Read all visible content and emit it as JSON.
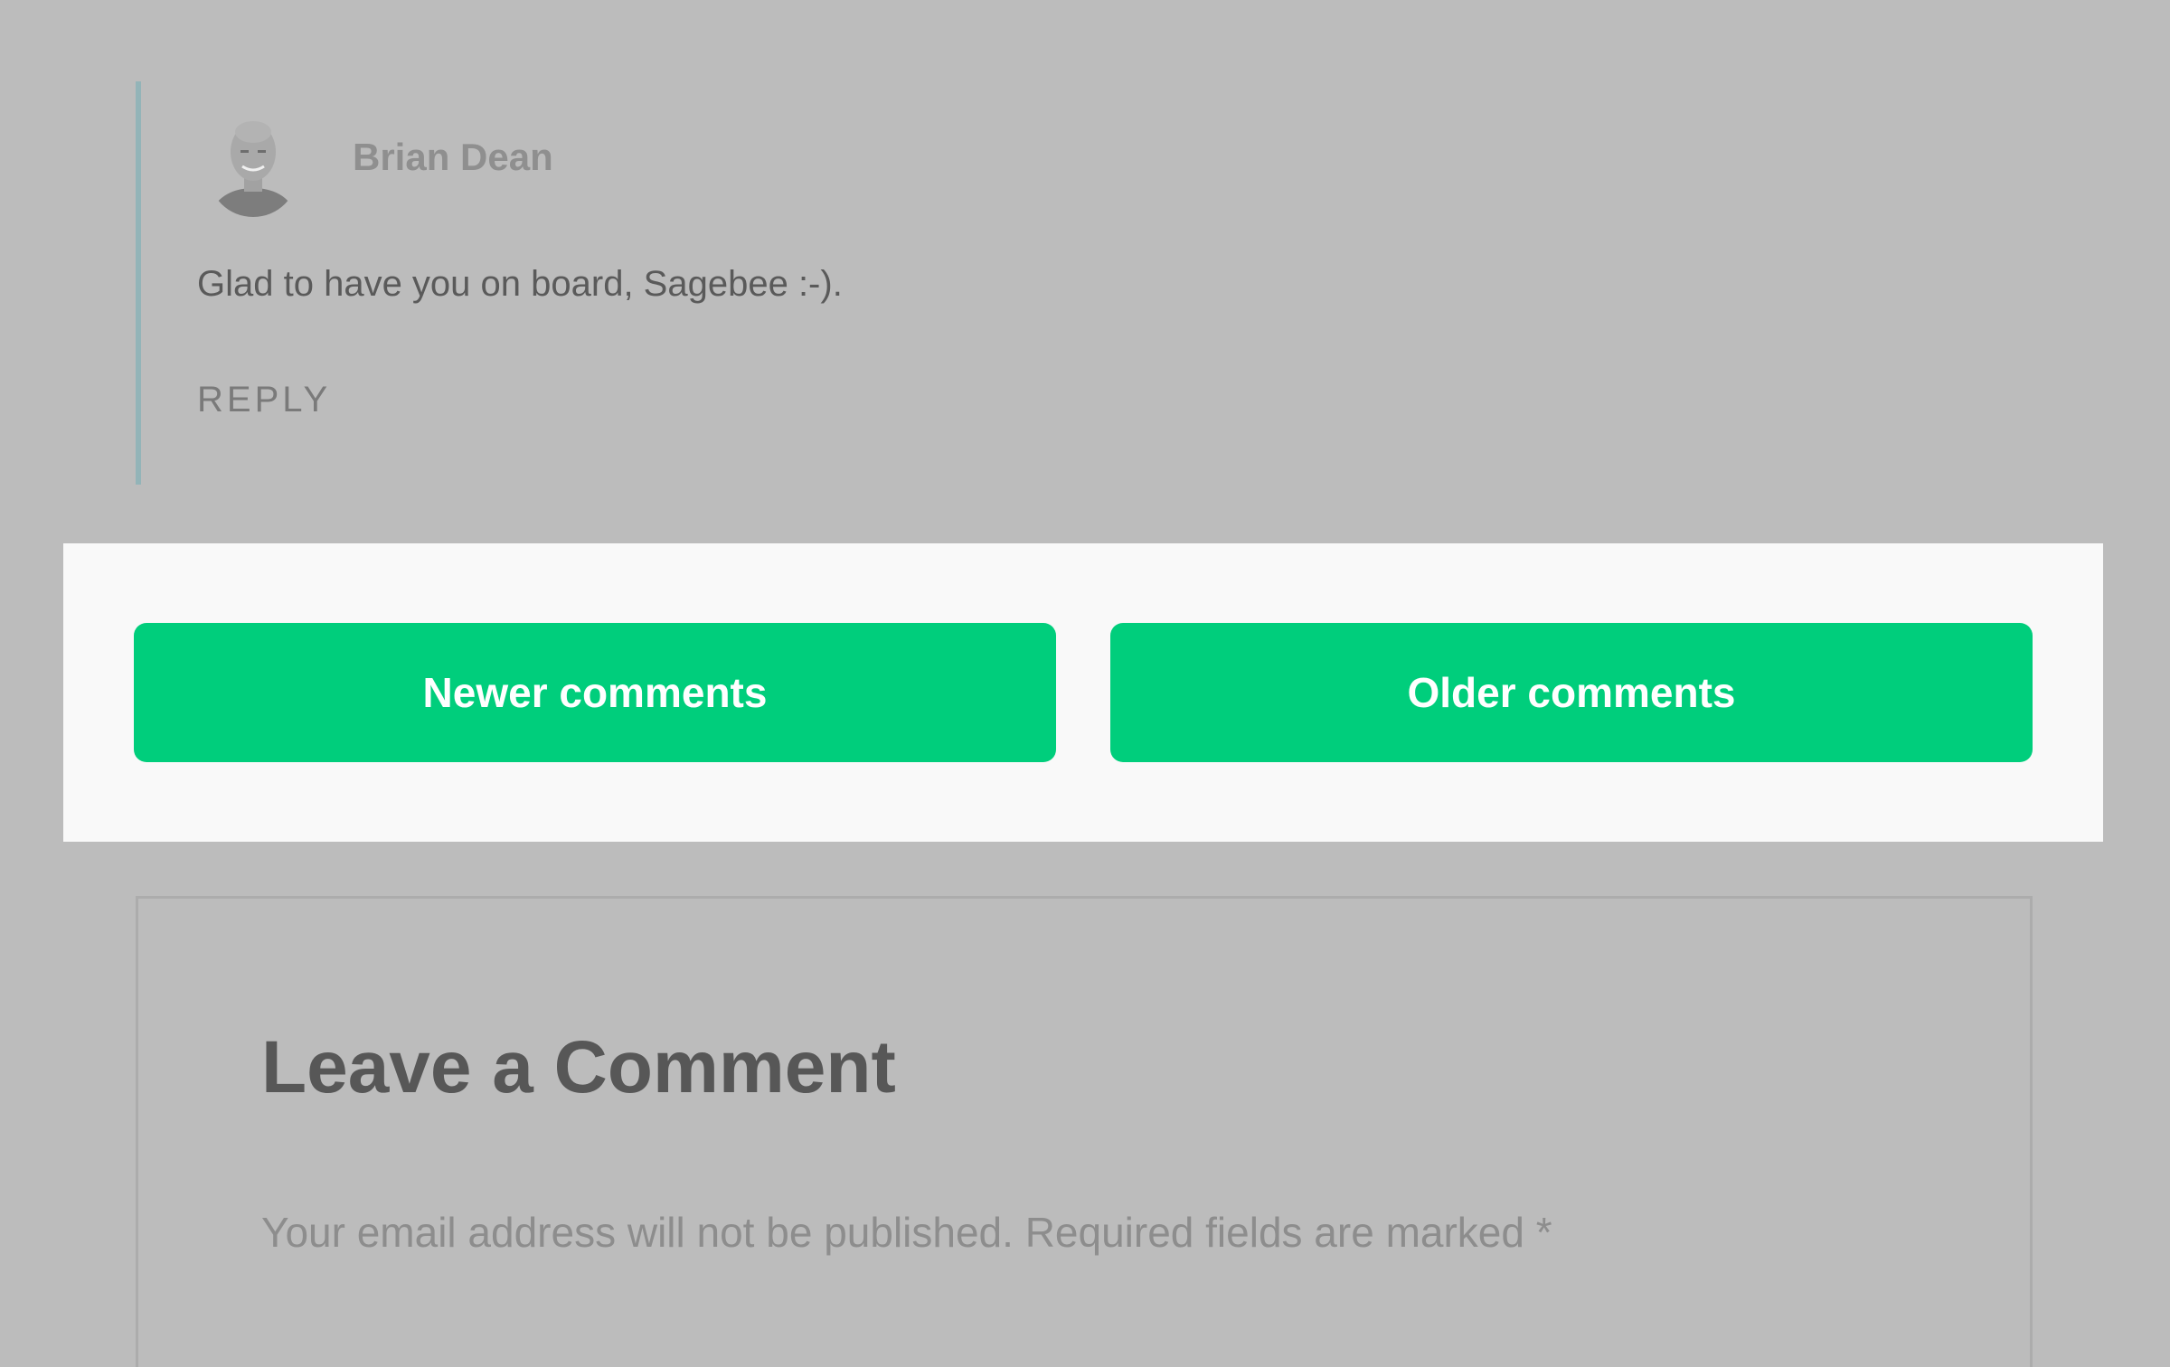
{
  "comment": {
    "author": "Brian Dean",
    "text": "Glad to have you on board, Sagebee :-).",
    "reply_label": "REPLY",
    "avatar_icon": "author-avatar"
  },
  "pagination": {
    "newer_label": "Newer comments",
    "older_label": "Older comments",
    "button_color": "#00ce7c"
  },
  "respond": {
    "title": "Leave a Comment",
    "note": "Your email address will not be published. Required fields are marked *"
  }
}
